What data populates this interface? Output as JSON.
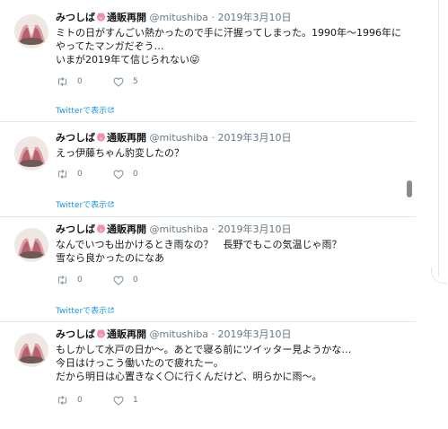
{
  "tweets": [
    {
      "display_name": "みつしば",
      "label": "通販再開",
      "handle": "@mitushiba",
      "separator": "·",
      "date": "2019年3月10日",
      "text": "ミトの日がすんごい熱かったので手に汗握ってしまった。1990年〜1996年に\nやってたマンガだぞう…\nいまが2019年て信じられない😜",
      "retweet_count": "0",
      "like_count": "5",
      "view_link": "Twitterで表示"
    },
    {
      "display_name": "みつしば",
      "label": "通販再開",
      "handle": "@mitushiba",
      "separator": "·",
      "date": "2019年3月10日",
      "text": "えっ伊藤ちゃん豹変したの？",
      "retweet_count": "0",
      "like_count": "0",
      "view_link": "Twitterで表示"
    },
    {
      "display_name": "みつしば",
      "label": "通販再開",
      "handle": "@mitushiba",
      "separator": "·",
      "date": "2019年3月10日",
      "text": "なんでいつも出かけるとき雨なの？　長野でもこの気温じゃ雨？\n雪なら良かったのになあ",
      "retweet_count": "0",
      "like_count": "0",
      "view_link": "Twitterで表示"
    },
    {
      "display_name": "みつしば",
      "label": "通販再開",
      "handle": "@mitushiba",
      "separator": "·",
      "date": "2019年3月10日",
      "text": "もしかして水戸の日か〜。あとで寝る前にツイッター見ようかな…\n今日はけっこう働いたので疲れたー。\nだから明日は心置きなく〇に行くんだけど、明らかに雨〜。",
      "retweet_count": "0",
      "like_count": "1",
      "view_link": ""
    }
  ],
  "icons": {
    "avatar": "avatar-image",
    "pig": "pig-icon",
    "retweet": "retweet-icon",
    "like": "heart-icon",
    "external": "external-link-icon"
  },
  "colors": {
    "link": "#1b95e0",
    "meta": "#657786",
    "text": "#14171a",
    "divider": "#e1e8ed",
    "pig": "#f08fb0"
  }
}
